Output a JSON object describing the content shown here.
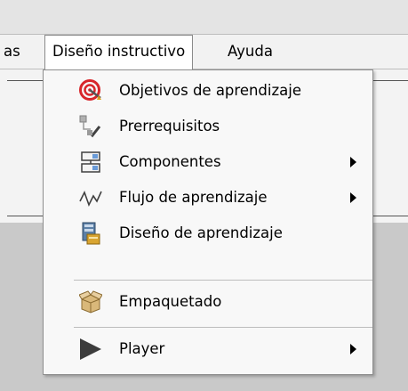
{
  "menubar": {
    "items": [
      {
        "label": "as"
      },
      {
        "label": "Diseño instructivo"
      },
      {
        "label": "Ayuda"
      }
    ]
  },
  "dropdown": {
    "items": [
      {
        "label": "Objetivos de aprendizaje",
        "icon": "target-icon",
        "submenu": false
      },
      {
        "label": "Prerrequisitos",
        "icon": "prerequisites-icon",
        "submenu": false
      },
      {
        "label": "Componentes",
        "icon": "components-icon",
        "submenu": true
      },
      {
        "label": "Flujo de aprendizaje",
        "icon": "learning-flow-icon",
        "submenu": true
      },
      {
        "label": "Diseño de aprendizaje",
        "icon": "learning-design-icon",
        "submenu": false
      },
      {
        "label": "Empaquetado",
        "icon": "package-icon",
        "submenu": false
      },
      {
        "label": "Player",
        "icon": "play-icon",
        "submenu": true
      }
    ]
  }
}
